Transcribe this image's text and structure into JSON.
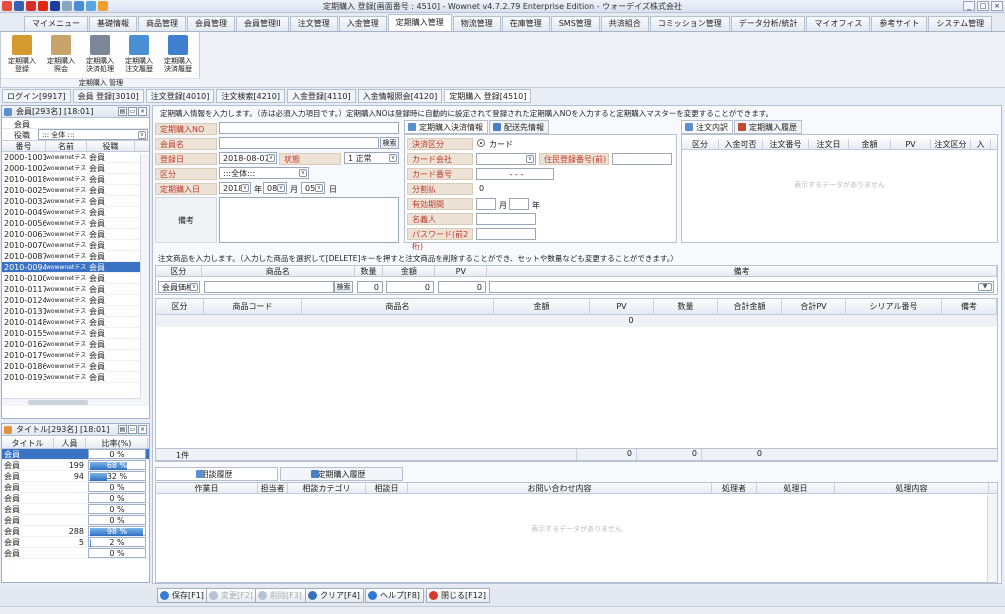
{
  "window": {
    "title": "定期購入 登録[画面番号 : 4510] - Wownet v4.7.2.79 Enterprise Edition - ウォーデイズ株式会社"
  },
  "menu": [
    "マイメニュー",
    "基礎情報",
    "商品管理",
    "会員管理",
    "会員管理II",
    "注文管理",
    "入金管理",
    "定期購入管理",
    "物流管理",
    "在庫管理",
    "SMS管理",
    "共済組合",
    "コミッション管理",
    "データ分析/統計",
    "マイオフィス",
    "参考サイト",
    "システム管理"
  ],
  "menu_active": 7,
  "ribbon": {
    "buttons": [
      {
        "l1": "定期購入",
        "l2": "登録",
        "l3": ""
      },
      {
        "l1": "定期購入",
        "l2": "照会",
        "l3": ""
      },
      {
        "l1": "定期購入",
        "l2": "決済処理",
        "l3": ""
      },
      {
        "l1": "定期購入",
        "l2": "注文履歴",
        "l3": ""
      },
      {
        "l1": "定期購入",
        "l2": "決済履歴",
        "l3": ""
      }
    ],
    "group": "定期購入 管理"
  },
  "doc_tabs": [
    "ログイン[9917]",
    "会員 登録[3010]",
    "注文登録[4010]",
    "注文検索[4210]",
    "入金登録[4110]",
    "入金情報照会[4120]",
    "定期購入 登録[4510]"
  ],
  "doc_tab_active": 6,
  "member_panel": {
    "title": "会員[293名] [18:01]",
    "filter_label_1": "会員",
    "filter_label_2": "役職",
    "filter_value": "::: 全体 :::",
    "headers": [
      "番号",
      "名前",
      "役職"
    ],
    "rows": [
      [
        "2000-1001",
        "wowwnetテスト",
        "会員"
      ],
      [
        "2000-1002",
        "wowwnetテスト",
        "会員"
      ],
      [
        "2010-0018",
        "wowwnetテスト",
        "会員"
      ],
      [
        "2010-0025",
        "wowwnetテスト",
        "会員"
      ],
      [
        "2010-0032",
        "wowwnetテスト",
        "会員"
      ],
      [
        "2010-0049",
        "wowwnetテスト",
        "会員"
      ],
      [
        "2010-0056",
        "wowwnetテスト",
        "会員"
      ],
      [
        "2010-0063",
        "wowwnetテスト",
        "会員"
      ],
      [
        "2010-0070",
        "wowwnetテスト",
        "会員"
      ],
      [
        "2010-0087",
        "wowwnetテスト",
        "会員"
      ],
      [
        "2010-0094",
        "wowwnetテスト",
        "会員"
      ],
      [
        "2010-0100",
        "wowwnetテスト",
        "会員"
      ],
      [
        "2010-0117",
        "wowwnetテスト",
        "会員"
      ],
      [
        "2010-0124",
        "wowwnetテスト",
        "会員"
      ],
      [
        "2010-0131",
        "wowwnetテスト",
        "会員"
      ],
      [
        "2010-0148",
        "wowwnetテスト",
        "会員"
      ],
      [
        "2010-0155",
        "wowwnetテスト",
        "会員"
      ],
      [
        "2010-0162",
        "wowwnetテスト",
        "会員"
      ],
      [
        "2010-0179",
        "wowwnetテスト",
        "会員"
      ],
      [
        "2010-0186",
        "wowwnetテスト",
        "会員"
      ],
      [
        "2010-0193",
        "wowwnetテスト",
        "会員"
      ]
    ],
    "selected_row": 10
  },
  "title_panel": {
    "title": "タイトル[293名] [18:01]",
    "headers": [
      "タイトル",
      "人員",
      "比率(%)"
    ],
    "rows": [
      {
        "name": "会員",
        "count": "",
        "ratio": "0 %",
        "frac": 0
      },
      {
        "name": "会員",
        "count": "199",
        "ratio": "68 %",
        "frac": 0.68
      },
      {
        "name": "会員",
        "count": "94",
        "ratio": "32 %",
        "frac": 0.32
      },
      {
        "name": "会員",
        "count": "",
        "ratio": "0 %",
        "frac": 0
      },
      {
        "name": "会員",
        "count": "",
        "ratio": "0 %",
        "frac": 0
      },
      {
        "name": "会員",
        "count": "",
        "ratio": "0 %",
        "frac": 0
      },
      {
        "name": "会員",
        "count": "",
        "ratio": "0 %",
        "frac": 0
      },
      {
        "name": "会員",
        "count": "288",
        "ratio": "98 %",
        "frac": 0.98
      },
      {
        "name": "会員",
        "count": "5",
        "ratio": "2 %",
        "frac": 0.02
      },
      {
        "name": "会員",
        "count": "",
        "ratio": "0 %",
        "frac": 0
      }
    ],
    "selected_row": 0
  },
  "instruction": "定期購入情報を入力します。（赤は必須入力項目です。）定期購入NOは登録時に自動的に設定されて登録された定期購入NOを入力すると定期購入マスターを変更することができます。",
  "form": {
    "label_no": "定期購入NO",
    "label_member": "会員名",
    "member_search": "検索",
    "label_regdate": "登録日",
    "regdate": "2018-08-07",
    "label_status": "状態",
    "status": "1 正常",
    "label_kubun": "区分",
    "kubun": ":::全体:::",
    "label_buydate": "定期購入日",
    "buy_year": "2018",
    "year_unit": "年",
    "buy_month": "08",
    "month_unit": "月",
    "buy_day": "05",
    "day_unit": "日",
    "label_note": "備考"
  },
  "payment": {
    "tab1": "定期購入決済情報",
    "tab2": "配送先情報",
    "label_method": "決済区分",
    "method": "カード",
    "label_company": "カード会社",
    "label_resident": "住民登録番号(前)",
    "label_cardno": "カード番号",
    "cardno": "-  -  -",
    "label_install": "分割払",
    "install": "0",
    "label_expiry": "有効期間",
    "expiry_month": "月",
    "expiry_year": "年",
    "label_holder": "名義人",
    "label_password": "パスワード(前2桁)"
  },
  "history": {
    "tab1": "注文内訳",
    "tab2": "定期購入履歴",
    "headers": [
      "区分",
      "入金可否",
      "注文番号",
      "注文日",
      "金額",
      "PV",
      "注文区分",
      "入"
    ],
    "empty": "表示するデータがありません"
  },
  "product_entry": {
    "instruction": "注文商品を入力します。（入力した商品を選択して[DELETE]キーを押すと注文商品を削除することができ、セットや数量なども変更することができます。）",
    "headers": [
      "区分",
      "商品名",
      "数量",
      "金額",
      "PV",
      "備考"
    ],
    "kubun": "会員価格",
    "search": "検索",
    "qty": "0",
    "amount": "0",
    "pv": "0"
  },
  "product_grid": {
    "headers": [
      "区分",
      "商品コード",
      "商品名",
      "金額",
      "PV",
      "数量",
      "合計金額",
      "合計PV",
      "シリアル番号",
      "備考"
    ],
    "row_qty": "0",
    "footer_count": "1件",
    "footer_total1": "0",
    "footer_total2": "0",
    "footer_total3": "0"
  },
  "consult": {
    "tab1": "相談履歴",
    "tab2": "定期購入履歴",
    "headers": [
      "作業日",
      "担当者",
      "相談カテゴリ",
      "相談日",
      "お問い合わせ内容",
      "処理者",
      "処理日",
      "処理内容"
    ],
    "empty": "表示するデータがありません"
  },
  "bottom_buttons": [
    {
      "label": "保存[F1]",
      "enabled": true,
      "color": "#3a7bd5"
    },
    {
      "label": "変更[F2]",
      "enabled": false,
      "color": "#b8c2d0"
    },
    {
      "label": "削除[F3]",
      "enabled": false,
      "color": "#b8c2d0"
    },
    {
      "label": "クリア[F4]",
      "enabled": true,
      "color": "#3b6fb6"
    },
    {
      "label": "ヘルプ[F8]",
      "enabled": true,
      "color": "#2f78d2"
    },
    {
      "label": "閉じる[F12]",
      "enabled": true,
      "color": "#d63b2a"
    }
  ]
}
